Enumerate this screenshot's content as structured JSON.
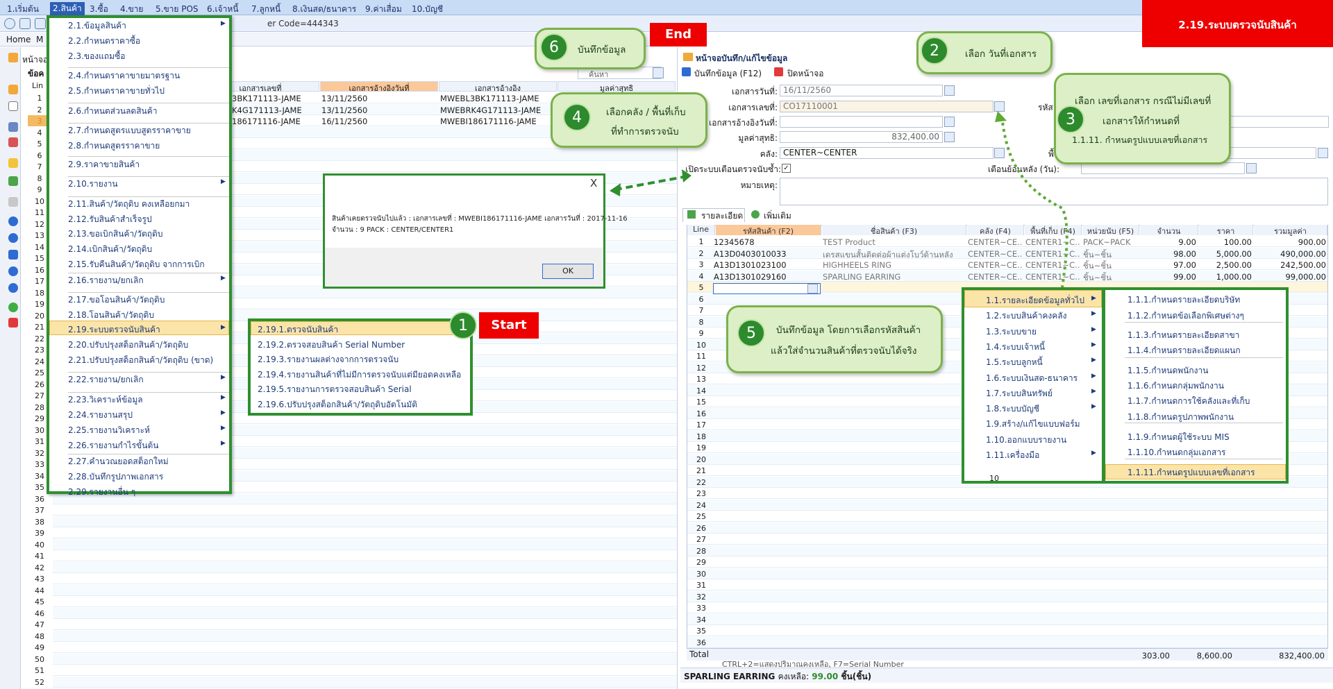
{
  "app": {
    "banner": "2.19.ระบบตรวจนับสินค้า",
    "user_code": "er Code=444343"
  },
  "menubar": [
    "1.เริ่มต้น",
    "2.สินค้า",
    "3.ซื้อ",
    "4.ขาย",
    "5.ขาย POS",
    "6.เจ้าหนี้",
    "7.ลูกหนี้",
    "8.เงินสด/ธนาคาร",
    "9.ค่าเสื่อม",
    "10.บัญชี"
  ],
  "header": {
    "home": "Home",
    "tab2": "M",
    "left_title": "หน้าจอ",
    "left_sub": "ข้อค",
    "line_label": "Lin"
  },
  "left_grid": {
    "col_doc_no": "เอกสารเลขที่",
    "col_ref_date": "เอกสารอ้างอิงวันที่",
    "col_ref": "เอกสารอ้างอิง",
    "col_net": "มูลค่าสุทธิ",
    "search_label": "ค้นหา",
    "rows": [
      {
        "doc": "3BK171113-JAME",
        "date": "13/11/2560",
        "ref": "MWEBL3BK171113-JAME"
      },
      {
        "doc": "K4G171113-JAME",
        "date": "13/11/2560",
        "ref": "MWEBRK4G171113-JAME"
      },
      {
        "doc": "186171116-JAME",
        "date": "16/11/2560",
        "ref": "MWEBI186171116-JAME"
      }
    ],
    "line_numbers": [
      "1",
      "2",
      "3",
      "4",
      "5",
      "6",
      "7",
      "8",
      "9",
      "10",
      "11",
      "12",
      "13",
      "14",
      "15",
      "16",
      "17",
      "18",
      "19",
      "20",
      "21",
      "22",
      "23",
      "24",
      "25",
      "26",
      "27",
      "28",
      "29",
      "30",
      "31",
      "32",
      "33",
      "34",
      "35",
      "36",
      "37",
      "38",
      "39",
      "40",
      "41",
      "42",
      "43",
      "44",
      "45",
      "46",
      "47",
      "48",
      "49",
      "50",
      "51",
      "52"
    ]
  },
  "main_menu": [
    {
      "label": "2.1.ข้อมูลสินค้า",
      "sub": true
    },
    {
      "label": "2.2.กำหนดราคาซื้อ"
    },
    {
      "label": "2.3.ของแถมซื้อ"
    },
    {
      "label": "2.4.กำหนดราคาขายมาตรฐาน"
    },
    {
      "label": "2.5.กำหนดราคาขายทั่วไป"
    },
    {
      "label": "2.6.กำหนดส่วนลดสินค้า"
    },
    {
      "label": "2.7.กำหนดสูตรแบบสูตรราคาขาย"
    },
    {
      "label": "2.8.กำหนดสูตรราคาขาย"
    },
    {
      "label": "2.9.ราคาขายสินค้า"
    },
    {
      "label": "2.10.รายงาน",
      "sub": true
    },
    {
      "label": "2.11.สินค้า/วัตถุดิบ คงเหลือยกมา"
    },
    {
      "label": "2.12.รับสินค้าสำเร็จรูป"
    },
    {
      "label": "2.13.ขอเบิกสินค้า/วัตถุดิบ"
    },
    {
      "label": "2.14.เบิกสินค้า/วัตถุดิบ"
    },
    {
      "label": "2.15.รับคืนสินค้า/วัตถุดิบ จากการเบิก"
    },
    {
      "label": "2.16.รายงาน/ยกเลิก",
      "sub": true
    },
    {
      "label": "2.17.ขอโอนสินค้า/วัตถุดิบ"
    },
    {
      "label": "2.18.โอนสินค้า/วัตถุดิบ"
    },
    {
      "label": "2.19.ระบบตรวจนับสินค้า",
      "sub": true
    },
    {
      "label": "2.20.ปรับปรุงสต็อกสินค้า/วัตถุดิบ"
    },
    {
      "label": "2.21.ปรับปรุงสต็อกสินค้า/วัตถุดิบ (ขาด)"
    },
    {
      "label": "2.22.รายงาน/ยกเลิก",
      "sub": true
    },
    {
      "label": "2.23.วิเคราะห์ข้อมูล",
      "sub": true
    },
    {
      "label": "2.24.รายงานสรุป",
      "sub": true
    },
    {
      "label": "2.25.รายงานวิเคราะห์",
      "sub": true
    },
    {
      "label": "2.26.รายงานกำไรขั้นต้น",
      "sub": true
    },
    {
      "label": "2.27.คำนวณยอดสต็อกใหม่"
    },
    {
      "label": "2.28.บันทึกรูปภาพเอกสาร"
    },
    {
      "label": "2.29.รายงานอื่น ๆ"
    }
  ],
  "sub_menu": [
    "2.19.1.ตรวจนับสินค้า",
    "2.19.2.ตรวจสอบสินค้า Serial Number",
    "2.19.3.รายงานผลต่างจากการตรวจนับ",
    "2.19.4.รายงานสินค้าที่ไม่มีการตรวจนับแต่มียอดคงเหลือ",
    "2.19.5.รายงานการตรวจสอบสินค้า Serial",
    "2.19.6.ปรับปรุงสต็อกสินค้า/วัตถุดิบอัตโนมัติ"
  ],
  "dialog": {
    "close": "X",
    "line1": "สินค้าเคยตรวจนับไปแล้ว : เอกสารเลขที่ : MWEBI186171116-JAME เอกสารวันที่ : 2017-11-16",
    "line2": "จำนวน : 9 PACK : CENTER/CENTER1",
    "ok": "OK"
  },
  "form": {
    "title": "หน้าจอบันทึก/แก้ไขข้อมูล",
    "save_btn": "บันทึกข้อมูล (F12)",
    "close_btn": "ปิดหน้าจอ",
    "doc_date_label": "เอกสารวันที่:",
    "doc_date": "16/11/2560",
    "doc_no_label": "เอกสารเลขที่:",
    "doc_no": "CO17110001",
    "ref_date_label": "เอกสารอ้างอิงวันที่:",
    "net_label": "มูลค่าสุทธิ:",
    "net": "832,400.00",
    "wh_label": "คลัง:",
    "wh": "CENTER~CENTER",
    "remind_label": "เปิดระบบเตือนตรวจนับซ้ำ:",
    "remind_back_label": "เตือนย้อนหลัง (วัน):",
    "note_label": "หมายเหตุ:",
    "r1_label": "รหัส",
    "r2_label": "พื้"
  },
  "tabs": [
    "รายละเอียด",
    "เพิ่มเติม"
  ],
  "detail_grid": {
    "headers": [
      "Line",
      "รหัสสินค้า (F2)",
      "ชื่อสินค้า (F3)",
      "คลัง (F4)",
      "พื้นที่เก็บ (F4)",
      "หน่วยนับ (F5)",
      "จำนวน",
      "ราคา",
      "รวมมูลค่า"
    ],
    "rows": [
      {
        "code": "12345678",
        "name": "TEST Product",
        "wh": "CENTER~CE..",
        "loc": "CENTER1~C..",
        "unit": "PACK~PACK",
        "qty": "9.00",
        "price": "100.00",
        "total": "900.00"
      },
      {
        "code": "A13D0403010033",
        "name": "เดรสแขนสั้นติดต่อผ้าแต่งโบว์ด้านหลัง",
        "wh": "CENTER~CE..",
        "loc": "CENTER1~C..",
        "unit": "ชิ้น~ชิ้น",
        "qty": "98.00",
        "price": "5,000.00",
        "total": "490,000.00"
      },
      {
        "code": "A13D1301023100",
        "name": "HIGHHEELS RING",
        "wh": "CENTER~CE..",
        "loc": "CENTER1~C..",
        "unit": "ชิ้น~ชิ้น",
        "qty": "97.00",
        "price": "2,500.00",
        "total": "242,500.00"
      },
      {
        "code": "A13D1301029160",
        "name": "SPARLING EARRING",
        "wh": "CENTER~CE..",
        "loc": "CENTER1~C..",
        "unit": "ชิ้น~ชิ้น",
        "qty": "99.00",
        "price": "1,000.00",
        "total": "99,000.00"
      }
    ],
    "line_numbers": [
      "1",
      "2",
      "3",
      "4",
      "5",
      "6",
      "7",
      "8",
      "9",
      "10",
      "11",
      "12",
      "13",
      "14",
      "15",
      "16",
      "17",
      "18",
      "19",
      "20",
      "21",
      "22",
      "23",
      "24",
      "25",
      "26",
      "27",
      "28",
      "29",
      "30",
      "31",
      "32",
      "33",
      "34",
      "35",
      "36"
    ],
    "total_label": "Total",
    "total_qty": "303.00",
    "total_price": "8,600.00",
    "total_sum": "832,400.00",
    "hint": "CTRL+2=แสดงปริมาณคงเหลือ, F7=Serial Number"
  },
  "status": {
    "name": "SPARLING EARRING",
    "label": "คงเหลือ:",
    "qty": "99.00",
    "unit": "ชิ้น(ชิ้น)"
  },
  "context_menu": [
    "1.1.รายละเอียดข้อมูลทั่วไป",
    "1.2.ระบบสินค้าคงคลัง",
    "1.3.ระบบขาย",
    "1.4.ระบบเจ้าหนี้",
    "1.5.ระบบลูกหนี้",
    "1.6.ระบบเงินสด-ธนาคาร",
    "1.7.ระบบสินทรัพย์",
    "1.8.ระบบบัญชี",
    "1.9.สร้าง/แก้ไขแบบฟอร์ม",
    "1.10.ออกแบบรายงาน",
    "1.11.เครื่องมือ"
  ],
  "context_sub": [
    "1.1.1.กำหนดรายละเอียดบริษัท",
    "1.1.2.กำหนดข้อเลือกพิเศษต่างๆ",
    "1.1.3.กำหนดรายละเอียดสาขา",
    "1.1.4.กำหนดรายละเอียดแผนก",
    "1.1.5.กำหนดพนักงาน",
    "1.1.6.กำหนดกลุ่มพนักงาน",
    "1.1.7.กำหนดการใช้คลังและที่เก็บ",
    "1.1.8.กำหนดรูปภาพพนักงาน",
    "1.1.9.กำหนดผู้ใช้ระบบ MIS",
    "1.1.10.กำหนดกลุ่มเอกสาร",
    "1.1.11.กำหนดรูปแบบเลขที่เอกสาร"
  ],
  "context_extra": "10",
  "callouts": {
    "start": "Start",
    "end": "End",
    "b1": "1",
    "b2": "2",
    "b3": "3",
    "b4": "4",
    "b5": "5",
    "b6": "6",
    "c2": "เลือก วันที่เอกสาร",
    "c3a": "เลือก เลขที่เอกสาร กรณีไม่มีเลขที่",
    "c3b": "เอกสารให้กำหนดที่",
    "c3c": "1.1.11. กำหนดรูปแบบเลขที่เอกสาร",
    "c4a": "เลือกคลัง / พื้นที่เก็บ",
    "c4b": "ที่ทำการตรวจนับ",
    "c5a": "บันทึกข้อมูล โดยการเลือกรหัสสินค้า",
    "c5b": "แล้วใส่จำนวนสินค้าที่ตรวจนับได้จริง",
    "c6": "บันทึกข้อมูล"
  },
  "colors": {
    "accent_green": "#2f8f2f",
    "banner_red": "#ee0000",
    "bubble_fill": "#dcefc6",
    "menu_hl": "#fbe4a8"
  }
}
